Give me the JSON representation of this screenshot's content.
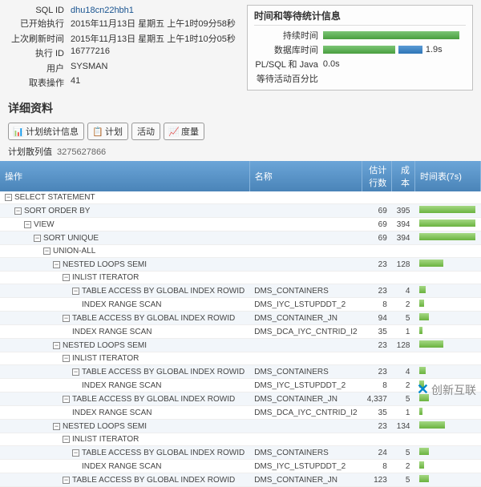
{
  "info": {
    "labels": {
      "sql_id": "SQL ID",
      "last_exec": "已开始执行",
      "last_refresh": "上次刷新时间",
      "exec_id": "执行 ID",
      "user": "用户",
      "fetch_ops": "取表操作"
    },
    "sql_id": "dhu18cn22hbh1",
    "last_exec": "2015年11月13日 星期五 上午1时09分58秒",
    "last_refresh": "2015年11月13日 星期五 上午1时10分05秒",
    "exec_id": "16777216",
    "user": "SYSMAN",
    "fetch_ops": "41"
  },
  "stats": {
    "title": "时间和等待统计信息",
    "rows": {
      "duration": "持续时间",
      "db_time": "数据库时间",
      "plsql_java": "PL/SQL 和 Java",
      "wait_pct": "等待活动百分比"
    },
    "db_time_value": "1.9s",
    "plsql_value": "0.0s"
  },
  "section": {
    "title": "详细资料"
  },
  "tabs": [
    "计划统计信息",
    "计划",
    "活动",
    "度量"
  ],
  "meta": {
    "label": "计划散列值",
    "value": "3275627866"
  },
  "columns": {
    "operation": "操作",
    "name": "名称",
    "est_rows": "估计行数",
    "cost": "成本",
    "time": "时间表(7s)"
  },
  "plan": [
    {
      "op": "SELECT STATEMENT",
      "name": "",
      "est": "",
      "cost": "",
      "ind": 0,
      "t": 1,
      "tw": 0
    },
    {
      "op": "SORT ORDER BY",
      "name": "",
      "est": "69",
      "cost": "395",
      "ind": 1,
      "t": 1,
      "tw": 70
    },
    {
      "op": "VIEW",
      "name": "",
      "est": "69",
      "cost": "394",
      "ind": 2,
      "t": 1,
      "tw": 70
    },
    {
      "op": "SORT UNIQUE",
      "name": "",
      "est": "69",
      "cost": "394",
      "ind": 3,
      "t": 1,
      "tw": 70
    },
    {
      "op": "UNION-ALL",
      "name": "",
      "est": "",
      "cost": "",
      "ind": 4,
      "t": 1,
      "tw": 0
    },
    {
      "op": "NESTED LOOPS SEMI",
      "name": "",
      "est": "23",
      "cost": "128",
      "ind": 5,
      "t": 1,
      "tw": 30
    },
    {
      "op": "INLIST ITERATOR",
      "name": "",
      "est": "",
      "cost": "",
      "ind": 6,
      "t": 1,
      "tw": 0
    },
    {
      "op": "TABLE ACCESS BY GLOBAL INDEX ROWID",
      "name": "DMS_CONTAINERS",
      "est": "23",
      "cost": "4",
      "ind": 7,
      "t": 1,
      "tw": 8
    },
    {
      "op": "INDEX RANGE SCAN",
      "name": "DMS_IYC_LSTUPDDT_2",
      "est": "8",
      "cost": "2",
      "ind": 8,
      "t": 0,
      "tw": 6
    },
    {
      "op": "TABLE ACCESS BY GLOBAL INDEX ROWID",
      "name": "DMS_CONTAINER_JN",
      "est": "94",
      "cost": "5",
      "ind": 6,
      "t": 1,
      "tw": 12
    },
    {
      "op": "INDEX RANGE SCAN",
      "name": "DMS_DCA_IYC_CNTRID_I2",
      "est": "35",
      "cost": "1",
      "ind": 7,
      "t": 0,
      "tw": 4
    },
    {
      "op": "NESTED LOOPS SEMI",
      "name": "",
      "est": "23",
      "cost": "128",
      "ind": 5,
      "t": 1,
      "tw": 30
    },
    {
      "op": "INLIST ITERATOR",
      "name": "",
      "est": "",
      "cost": "",
      "ind": 6,
      "t": 1,
      "tw": 0
    },
    {
      "op": "TABLE ACCESS BY GLOBAL INDEX ROWID",
      "name": "DMS_CONTAINERS",
      "est": "23",
      "cost": "4",
      "ind": 7,
      "t": 1,
      "tw": 8
    },
    {
      "op": "INDEX RANGE SCAN",
      "name": "DMS_IYC_LSTUPDDT_2",
      "est": "8",
      "cost": "2",
      "ind": 8,
      "t": 0,
      "tw": 6
    },
    {
      "op": "TABLE ACCESS BY GLOBAL INDEX ROWID",
      "name": "DMS_CONTAINER_JN",
      "est": "4,337",
      "cost": "5",
      "ind": 6,
      "t": 1,
      "tw": 12
    },
    {
      "op": "INDEX RANGE SCAN",
      "name": "DMS_DCA_IYC_CNTRID_I2",
      "est": "35",
      "cost": "1",
      "ind": 7,
      "t": 0,
      "tw": 4
    },
    {
      "op": "NESTED LOOPS SEMI",
      "name": "",
      "est": "23",
      "cost": "134",
      "ind": 5,
      "t": 1,
      "tw": 32
    },
    {
      "op": "INLIST ITERATOR",
      "name": "",
      "est": "",
      "cost": "",
      "ind": 6,
      "t": 1,
      "tw": 0
    },
    {
      "op": "TABLE ACCESS BY GLOBAL INDEX ROWID",
      "name": "DMS_CONTAINERS",
      "est": "24",
      "cost": "5",
      "ind": 7,
      "t": 1,
      "tw": 12
    },
    {
      "op": "INDEX RANGE SCAN",
      "name": "DMS_IYC_LSTUPDDT_2",
      "est": "8",
      "cost": "2",
      "ind": 8,
      "t": 0,
      "tw": 6
    },
    {
      "op": "TABLE ACCESS BY GLOBAL INDEX ROWID",
      "name": "DMS_CONTAINER_JN",
      "est": "123",
      "cost": "5",
      "ind": 6,
      "t": 1,
      "tw": 12
    }
  ],
  "logo": "创新互联"
}
